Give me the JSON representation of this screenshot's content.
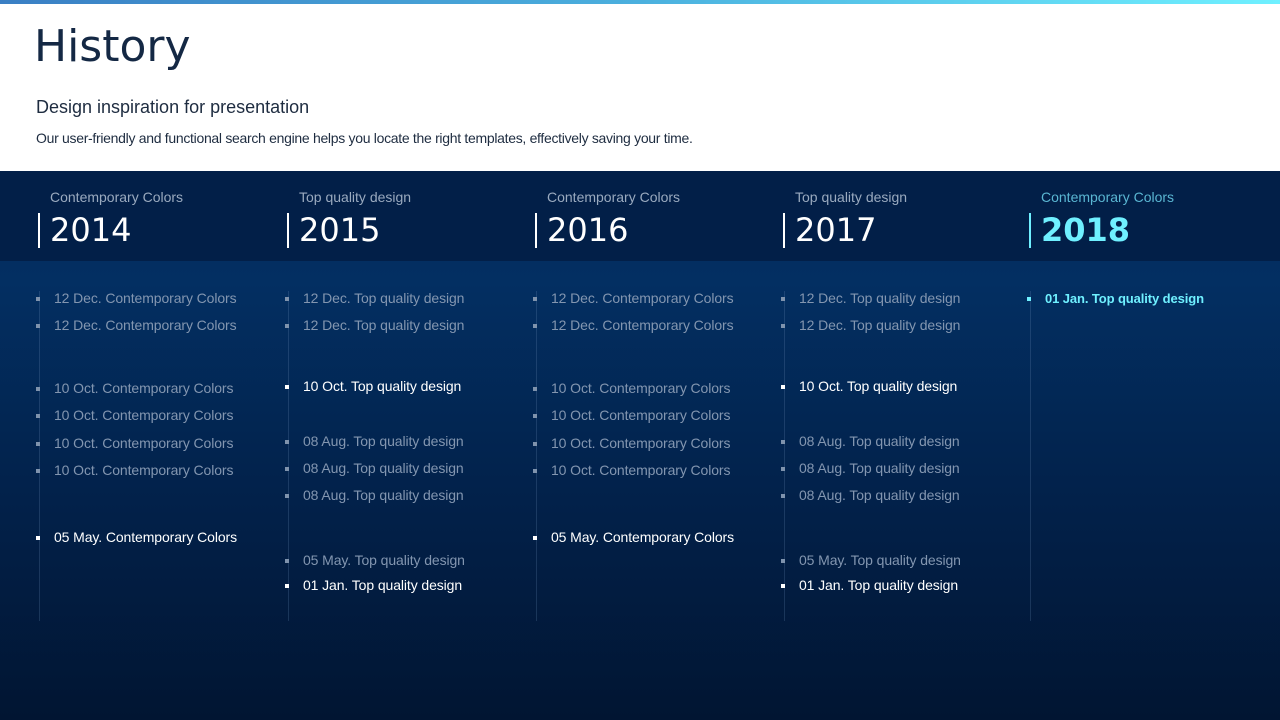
{
  "header": {
    "title": "History",
    "subtitle": "Design inspiration for presentation",
    "description": "Our user-friendly and functional search engine helps you locate the right templates, effectively saving your time."
  },
  "colors": {
    "accent": "#6ff0ff",
    "dark_background": "#022a5b",
    "title_text": "#142844"
  },
  "timeline": [
    {
      "label": "Contemporary Colors",
      "year": "2014",
      "entries": [
        {
          "text": "12 Dec.  Contemporary Colors",
          "highlight": false
        },
        {
          "text": "12 Dec.  Contemporary Colors",
          "highlight": false
        },
        {
          "text": "10 Oct.  Contemporary Colors",
          "highlight": false
        },
        {
          "text": "10 Oct.  Contemporary Colors",
          "highlight": false
        },
        {
          "text": "10 Oct.  Contemporary Colors",
          "highlight": false
        },
        {
          "text": "10 Oct.  Contemporary Colors",
          "highlight": false
        },
        {
          "text": "05 May.  Contemporary Colors",
          "highlight": true
        }
      ]
    },
    {
      "label": "Top quality design",
      "year": "2015",
      "entries": [
        {
          "text": "12 Dec. Top quality design",
          "highlight": false
        },
        {
          "text": "12 Dec. Top quality design",
          "highlight": false
        },
        {
          "text": "10 Oct. Top quality design",
          "highlight": true
        },
        {
          "text": "08 Aug. Top quality design",
          "highlight": false
        },
        {
          "text": "08 Aug. Top quality design",
          "highlight": false
        },
        {
          "text": "08 Aug. Top quality design",
          "highlight": false
        },
        {
          "text": "05 May. Top quality design",
          "highlight": false
        },
        {
          "text": "01 Jan. Top quality design",
          "highlight": true
        }
      ]
    },
    {
      "label": "Contemporary Colors",
      "year": "2016",
      "entries": [
        {
          "text": "12 Dec.  Contemporary Colors",
          "highlight": false
        },
        {
          "text": "12 Dec.  Contemporary Colors",
          "highlight": false
        },
        {
          "text": "10 Oct.  Contemporary Colors",
          "highlight": false
        },
        {
          "text": "10 Oct.  Contemporary Colors",
          "highlight": false
        },
        {
          "text": "10 Oct.  Contemporary Colors",
          "highlight": false
        },
        {
          "text": "10 Oct.  Contemporary Colors",
          "highlight": false
        },
        {
          "text": "05 May.  Contemporary Colors",
          "highlight": true
        }
      ]
    },
    {
      "label": "Top quality design",
      "year": "2017",
      "entries": [
        {
          "text": "12 Dec. Top quality design",
          "highlight": false
        },
        {
          "text": "12 Dec. Top quality design",
          "highlight": false
        },
        {
          "text": "10 Oct. Top quality design",
          "highlight": true
        },
        {
          "text": "08 Aug. Top quality design",
          "highlight": false
        },
        {
          "text": "08 Aug. Top quality design",
          "highlight": false
        },
        {
          "text": "08 Aug. Top quality design",
          "highlight": false
        },
        {
          "text": "05 May. Top quality design",
          "highlight": false
        },
        {
          "text": "01 Jan. Top quality design",
          "highlight": true
        }
      ]
    },
    {
      "label": "Contemporary Colors",
      "year": "2018",
      "active": true,
      "entries": [
        {
          "text": "01 Jan. Top quality design",
          "highlight": "accent"
        }
      ]
    }
  ]
}
